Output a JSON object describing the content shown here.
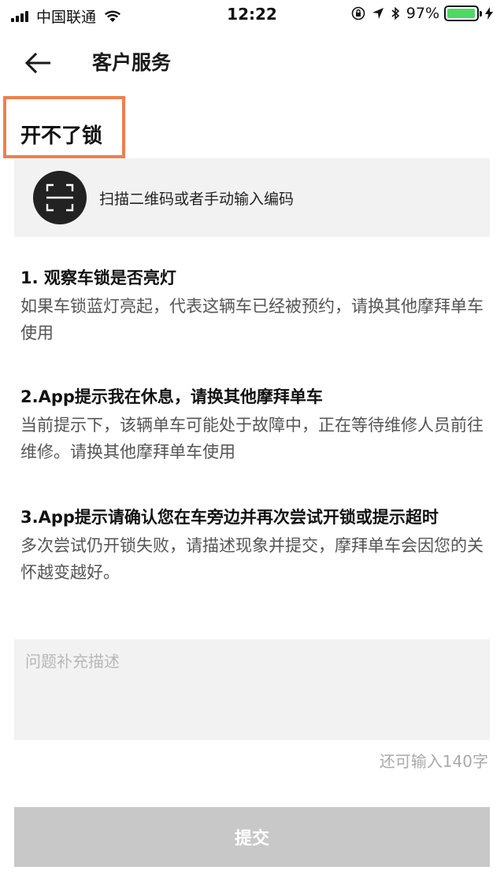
{
  "status_bar": {
    "carrier": "中国联通",
    "time": "12:22",
    "battery_percent": "97%",
    "battery_level": 0.97,
    "icons": [
      "signal-icon",
      "wifi-icon",
      "orientation-lock-icon",
      "location-icon",
      "bluetooth-icon",
      "battery-icon",
      "charging-icon"
    ]
  },
  "nav": {
    "title": "客户服务",
    "back_icon": "back-arrow-icon"
  },
  "issue": {
    "title": "开不了锁",
    "highlight_color": "#ef7f4f"
  },
  "scan": {
    "label": "扫描二维码或者手动输入编码",
    "icon": "scan-icon"
  },
  "tips": [
    {
      "title": "1. 观察车锁是否亮灯",
      "desc": "如果车锁蓝灯亮起，代表这辆车已经被预约，请换其他摩拜单车使用"
    },
    {
      "title": "2.App提示我在休息，请换其他摩拜单车",
      "desc": "当前提示下，该辆单车可能处于故障中，正在等待维修人员前往维修。请换其他摩拜单车使用"
    },
    {
      "title": "3.App提示请确认您在车旁边并再次尝试开锁或提示超时",
      "desc": "多次尝试仍开锁失败，请描述现象并提交，摩拜单车会因您的关怀越变越好。"
    }
  ],
  "form": {
    "placeholder": "问题补充描述",
    "value": "",
    "char_count": "还可输入140字",
    "submit_label": "提交"
  },
  "colors": {
    "accent_box": "#ef7f4f",
    "battery_fill": "#4cd964",
    "disabled_button": "#c8c8c8"
  }
}
